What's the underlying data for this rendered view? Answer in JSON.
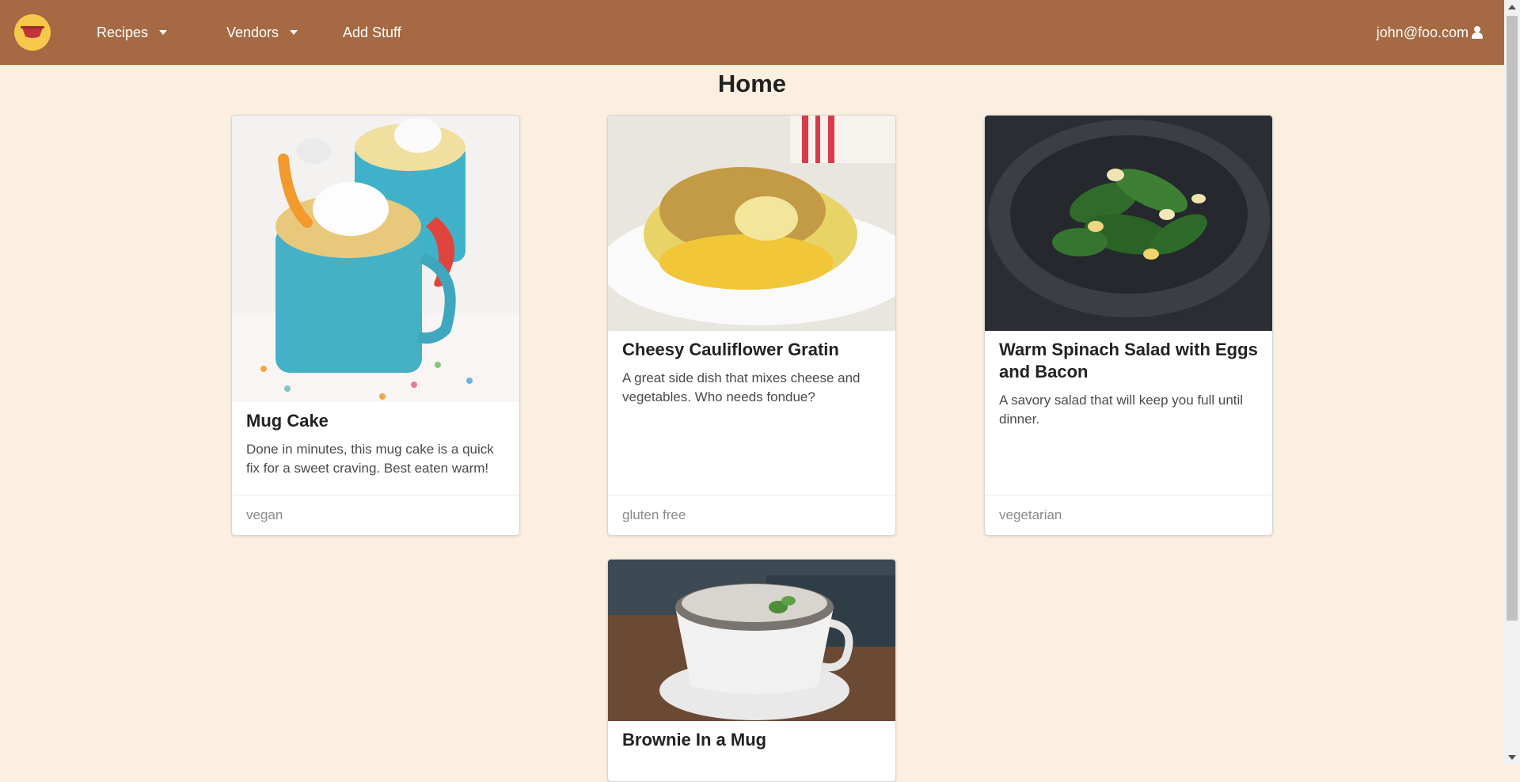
{
  "nav": {
    "logo_icon": "bowl-logo-icon",
    "items": [
      {
        "label": "Recipes",
        "dropdown": true
      },
      {
        "label": "Vendors",
        "dropdown": true
      },
      {
        "label": "Add Stuff",
        "dropdown": false
      }
    ],
    "user": {
      "label": "john@foo.com",
      "icon": "user-icon"
    }
  },
  "page": {
    "title": "Home"
  },
  "cards": [
    {
      "title": "Mug Cake",
      "description": "Done in minutes, this mug cake is a quick fix for a sweet craving. Best eaten warm!",
      "tag": "vegan",
      "image": "mug-cake-image"
    },
    {
      "title": "Cheesy Cauliflower Gratin",
      "description": "A great side dish that mixes cheese and vegetables. Who needs fondue?",
      "tag": "gluten free",
      "image": "cauliflower-gratin-image"
    },
    {
      "title": "Warm Spinach Salad with Eggs and Bacon",
      "description": "A savory salad that will keep you full until dinner.",
      "tag": "vegetarian",
      "image": "spinach-salad-image"
    },
    {
      "title": "Brownie In a Mug",
      "description": "",
      "tag": "",
      "image": "brownie-mug-image"
    }
  ],
  "colors": {
    "navbar": "#a56a43",
    "background": "#fbf0e0",
    "logo": "#f6c84c"
  }
}
